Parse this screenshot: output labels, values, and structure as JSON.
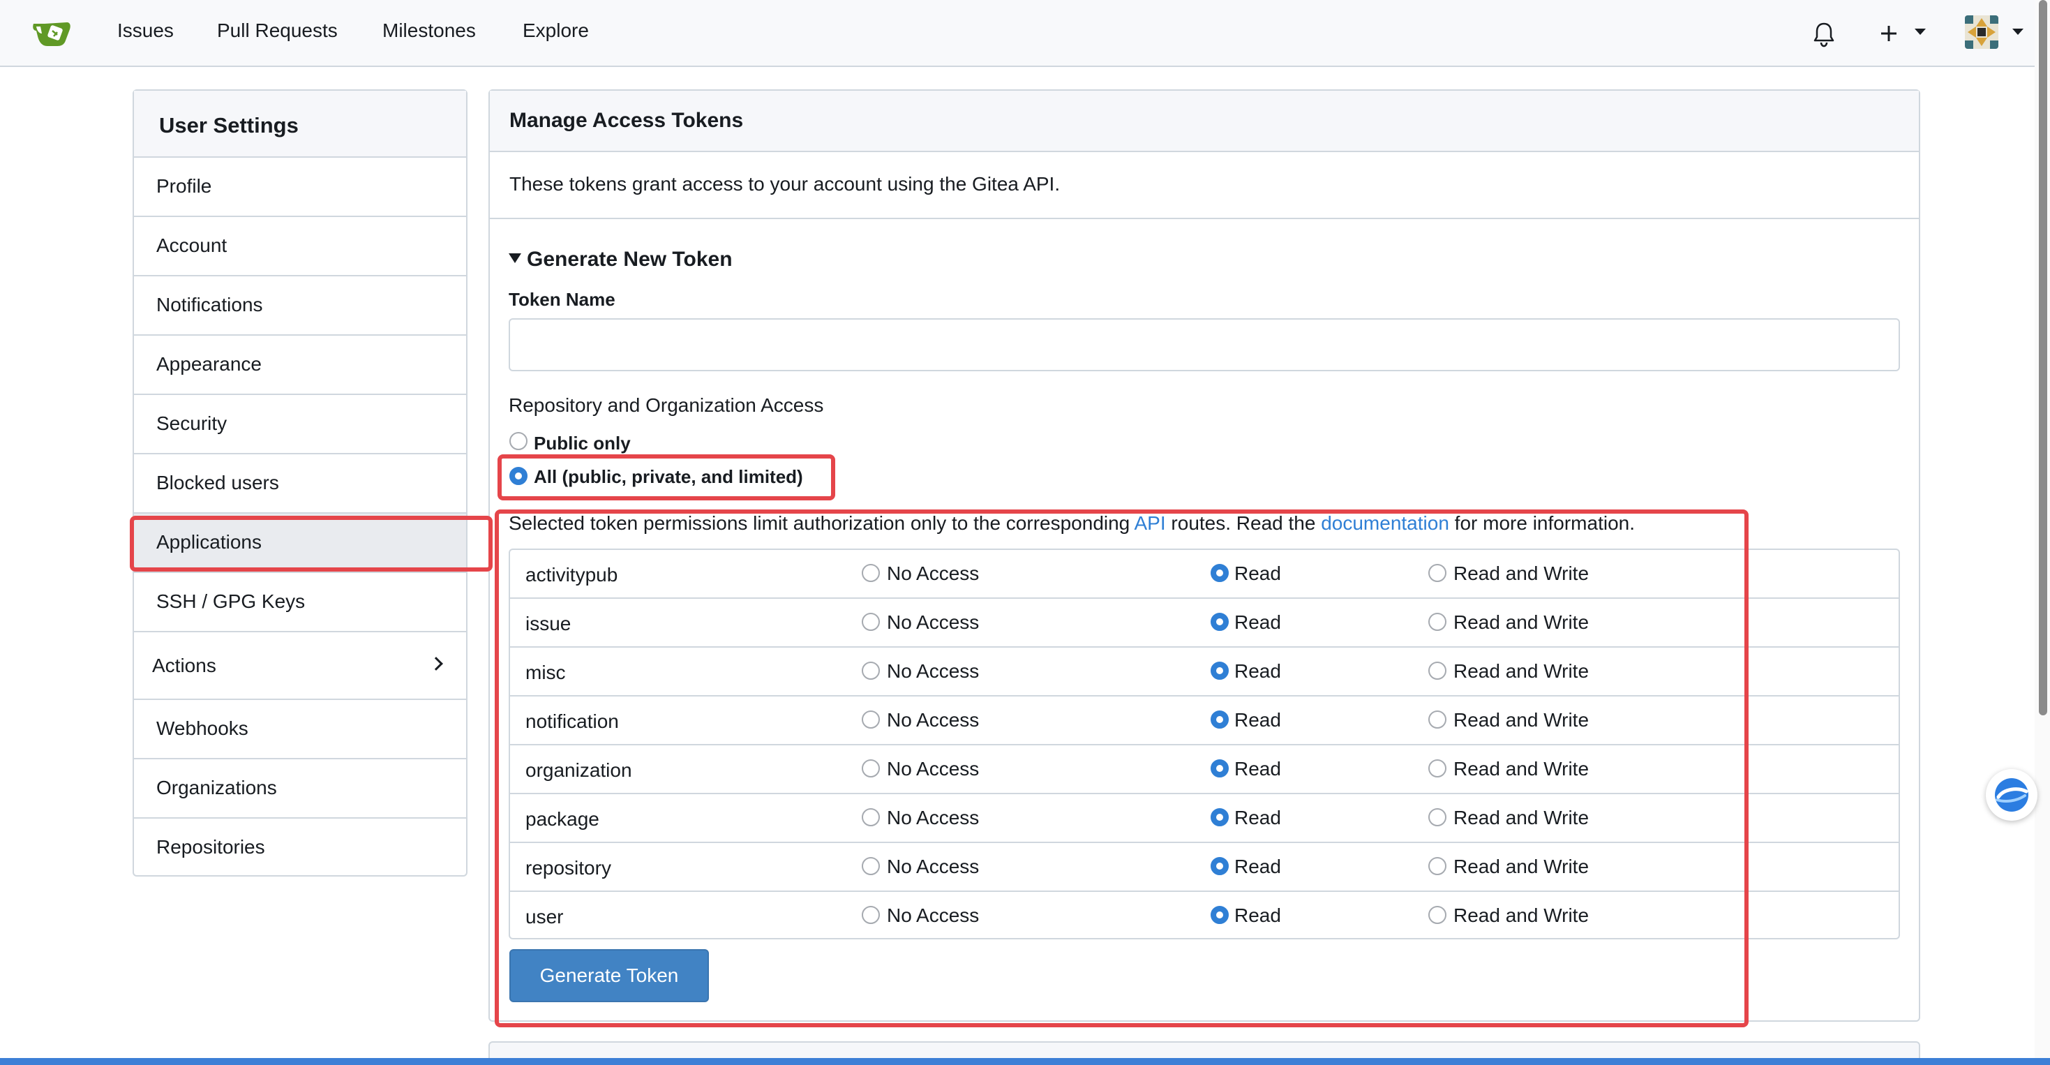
{
  "navbar": {
    "links": [
      "Issues",
      "Pull Requests",
      "Milestones",
      "Explore"
    ],
    "icons": [
      "bell-icon",
      "plus-icon",
      "avatar"
    ]
  },
  "sidebar": {
    "title": "User Settings",
    "items": [
      {
        "label": "Profile"
      },
      {
        "label": "Account"
      },
      {
        "label": "Notifications"
      },
      {
        "label": "Appearance"
      },
      {
        "label": "Security"
      },
      {
        "label": "Blocked users"
      },
      {
        "label": "Applications",
        "active": true
      },
      {
        "label": "SSH / GPG Keys"
      },
      {
        "label": "Actions"
      },
      {
        "label": "Webhooks"
      },
      {
        "label": "Organizations"
      },
      {
        "label": "Repositories"
      }
    ]
  },
  "main": {
    "title": "Manage Access Tokens",
    "description": "These tokens grant access to your account using the Gitea API.",
    "generate": {
      "summary": "Generate New Token",
      "token_name_label": "Token Name",
      "token_name_value": "",
      "access_label": "Repository and Organization Access",
      "access_options": [
        "Public only",
        "All (public, private, and limited)"
      ],
      "access_selected": "All (public, private, and limited)",
      "permissions_note_1": "Selected token permissions limit authorization only to the corresponding ",
      "permissions_note_link1": "API",
      "permissions_note_2": " routes. Read the ",
      "permissions_note_link2": "documentation",
      "permissions_note_3": " for more information.",
      "permission_levels": [
        "No Access",
        "Read",
        "Read and Write"
      ],
      "permissions": [
        {
          "category": "activitypub",
          "selected": "Read"
        },
        {
          "category": "issue",
          "selected": "Read"
        },
        {
          "category": "misc",
          "selected": "Read"
        },
        {
          "category": "notification",
          "selected": "Read"
        },
        {
          "category": "organization",
          "selected": "Read"
        },
        {
          "category": "package",
          "selected": "Read"
        },
        {
          "category": "repository",
          "selected": "Read"
        },
        {
          "category": "user",
          "selected": "Read"
        }
      ],
      "submit_label": "Generate Token"
    }
  },
  "colors": {
    "primary": "#4183c4",
    "link": "#2f7fd5",
    "highlight": "#e5454a",
    "logo_green": "#609926"
  }
}
